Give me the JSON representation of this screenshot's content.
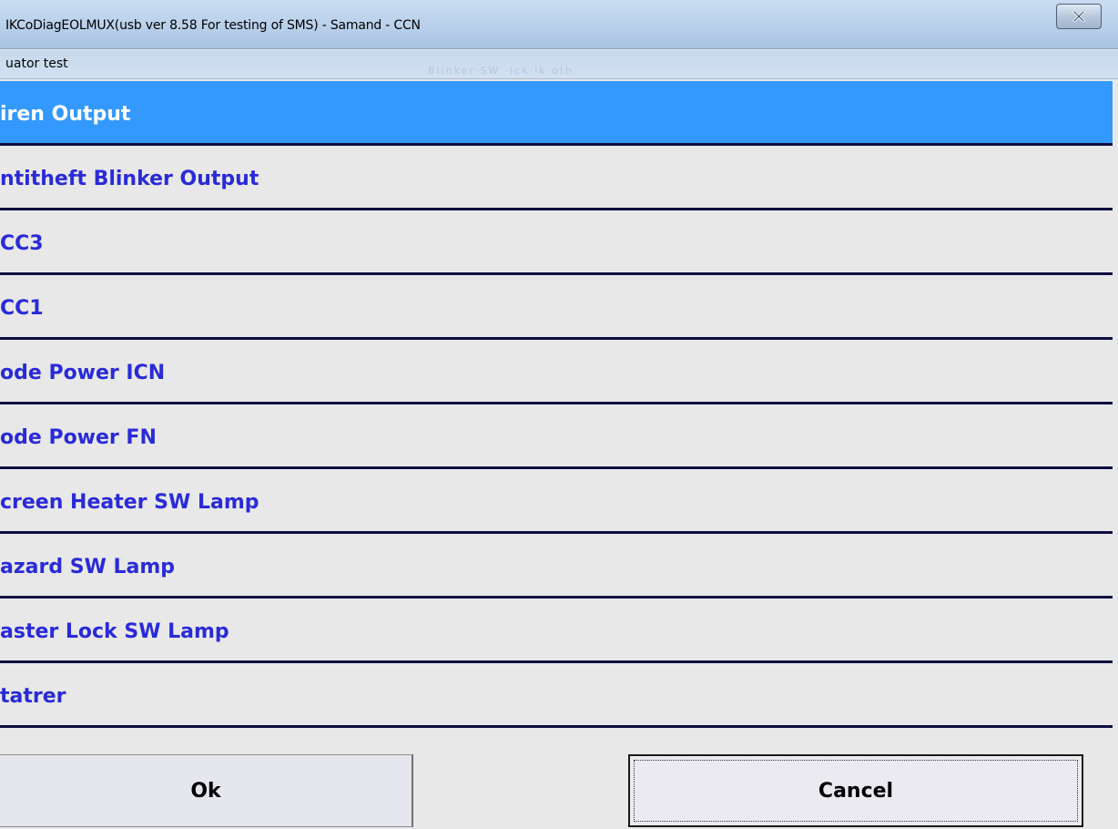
{
  "window": {
    "title": "IKCoDiagEOLMUX(usb ver 8.58 For testing of SMS)  - Samand - CCN",
    "close_icon": "close-icon",
    "subtitle": "uator test",
    "faint_text": "Blinker·SW  ·lck·lk·oth"
  },
  "list": {
    "items": [
      {
        "label": "iren Output",
        "selected": true
      },
      {
        "label": "ntitheft Blinker Output",
        "selected": false
      },
      {
        "label": "CC3",
        "selected": false
      },
      {
        "label": "CC1",
        "selected": false
      },
      {
        "label": "ode Power ICN",
        "selected": false
      },
      {
        "label": "ode Power FN",
        "selected": false
      },
      {
        "label": "creen Heater SW Lamp",
        "selected": false
      },
      {
        "label": "azard SW Lamp",
        "selected": false
      },
      {
        "label": "aster Lock SW Lamp",
        "selected": false
      },
      {
        "label": "tatrer",
        "selected": false
      }
    ]
  },
  "buttons": {
    "ok_label": "Ok",
    "cancel_label": "Cancel"
  },
  "colors": {
    "selected_row": "#3399ff",
    "item_text": "#2a2ad8",
    "row_separator": "#0e0f3f"
  }
}
